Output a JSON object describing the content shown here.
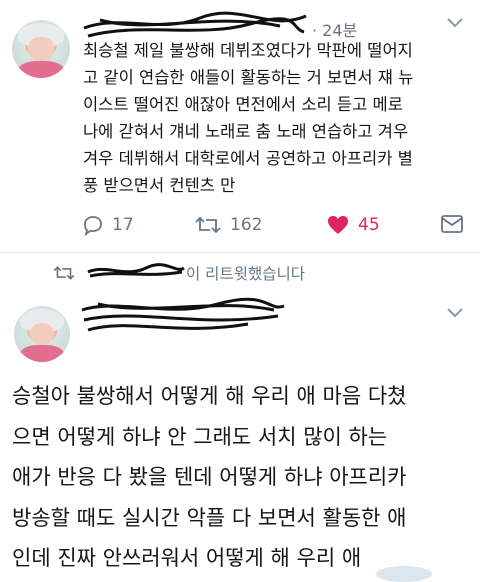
{
  "tweet1": {
    "timestamp": "· 24분",
    "text_lines": [
      "최승철 제일 불쌍해 데뷔조였다가 막판에 떨어지",
      "고 같이 연습한 애들이 활동하는 거 보면서 쟤 뉴",
      "이스트 떨어진 애잖아 면전에서 소리 듣고 메로",
      "나에 갇혀서 걔네 노래로 춤 노래 연습하고 겨우",
      "겨우 데뷔해서 대학로에서 공연하고 아프리카 별",
      "풍 받으면서 컨텐츠 만"
    ],
    "replies": "17",
    "retweets": "162",
    "likes": "45",
    "icons": [
      "reply-icon",
      "retweet-icon",
      "heart-icon",
      "dm-icon",
      "chevron-down-icon"
    ],
    "like_color": "#e0245e"
  },
  "retweet_notice": {
    "suffix": "이 리트윗했습니다"
  },
  "tweet2": {
    "text_lines": [
      "승철아 불쌍해서 어떻게 해 우리 애 마음 다쳤",
      "으면 어떻게 하냐 안 그래도 서치 많이 하는",
      "애가 반응 다 봤을 텐데 어떻게 하냐 아프리카",
      "방송할 때도 실시간 악플 다 보면서 활동한 애",
      "인데 진짜 안쓰러워서 어떻게 해 우리 애"
    ]
  }
}
